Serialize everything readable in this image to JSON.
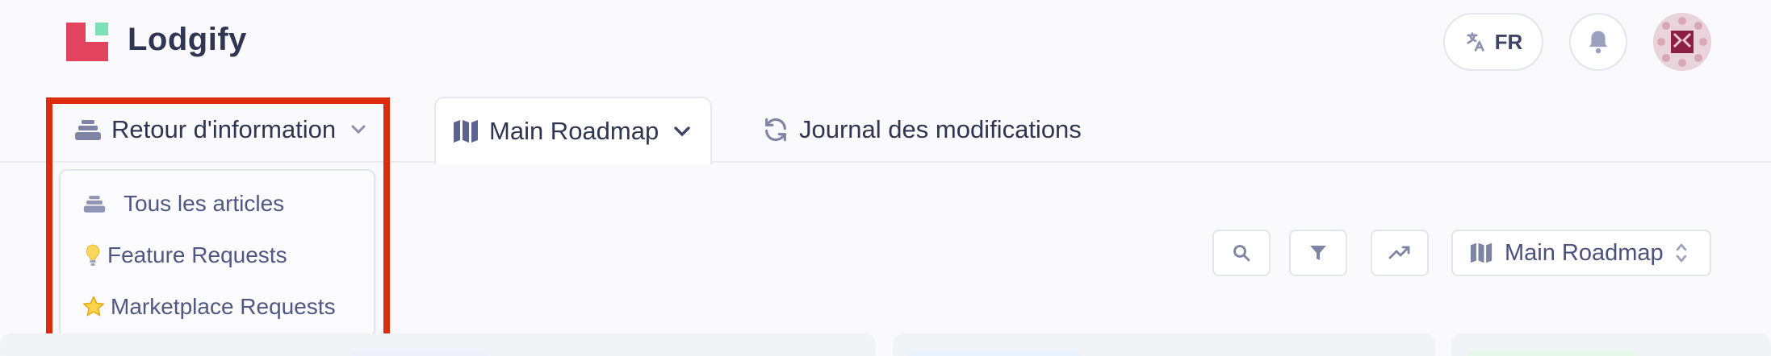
{
  "brand": {
    "name": "Lodgify"
  },
  "header": {
    "language_label": "FR",
    "language_icon": "translate-icon",
    "notifications_icon": "bell-icon",
    "avatar_icon": "user-avatar"
  },
  "tabs": [
    {
      "label": "Retour d'information",
      "icon": "stack-icon",
      "has_dropdown": true
    },
    {
      "label": "Main Roadmap",
      "icon": "map-icon",
      "has_dropdown": true,
      "active": true
    },
    {
      "label": "Journal des modifications",
      "icon": "refresh-icon",
      "has_dropdown": false
    }
  ],
  "dropdown": {
    "items": [
      {
        "label": "Tous les articles",
        "icon": "stack-icon"
      },
      {
        "label": "Feature Requests",
        "icon": "lightbulb-icon"
      },
      {
        "label": "Marketplace Requests",
        "icon": "star-icon"
      }
    ]
  },
  "toolbar": {
    "search_icon": "search-icon",
    "filter_icon": "filter-icon",
    "trend_icon": "trending-icon",
    "roadmap_select": "Main Roadmap"
  },
  "colors": {
    "brand_red": "#e2435e",
    "brand_green": "#7ee0b8",
    "highlight": "#dc2c0e",
    "text": "#3d4466"
  }
}
